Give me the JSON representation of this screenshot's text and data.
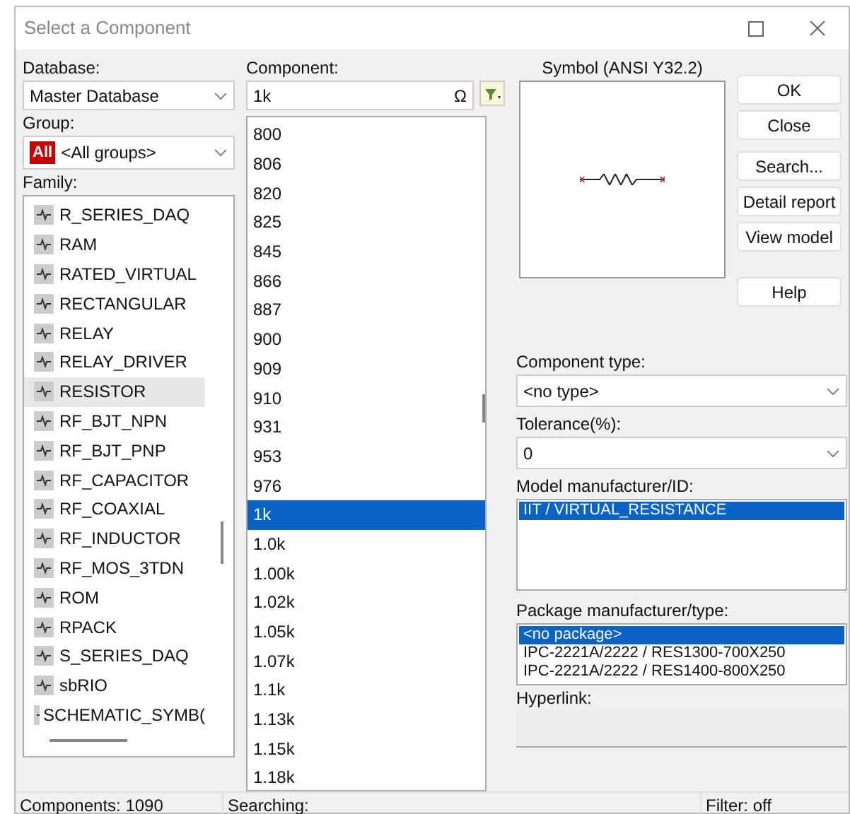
{
  "window": {
    "title": "Select a Component"
  },
  "database": {
    "label": "Database:",
    "value": "Master Database"
  },
  "group": {
    "label": "Group:",
    "badge": "All",
    "value": "<All groups>"
  },
  "family": {
    "label": "Family:",
    "items": [
      {
        "label": "R_SERIES_DAQ",
        "selected": false
      },
      {
        "label": "RAM",
        "selected": false
      },
      {
        "label": "RATED_VIRTUAL",
        "selected": false
      },
      {
        "label": "RECTANGULAR",
        "selected": false
      },
      {
        "label": "RELAY",
        "selected": false
      },
      {
        "label": "RELAY_DRIVER",
        "selected": false
      },
      {
        "label": "RESISTOR",
        "selected": true
      },
      {
        "label": "RF_BJT_NPN",
        "selected": false
      },
      {
        "label": "RF_BJT_PNP",
        "selected": false
      },
      {
        "label": "RF_CAPACITOR",
        "selected": false
      },
      {
        "label": "RF_COAXIAL",
        "selected": false
      },
      {
        "label": "RF_INDUCTOR",
        "selected": false
      },
      {
        "label": "RF_MOS_3TDN",
        "selected": false
      },
      {
        "label": "ROM",
        "selected": false
      },
      {
        "label": "RPACK",
        "selected": false
      },
      {
        "label": "S_SERIES_DAQ",
        "selected": false
      },
      {
        "label": "sbRIO",
        "selected": false
      },
      {
        "label": "SCHEMATIC_SYMB(",
        "selected": false
      }
    ]
  },
  "component": {
    "label": "Component:",
    "value": "1k",
    "omega_button": "Ω",
    "items": [
      {
        "label": "800",
        "selected": false
      },
      {
        "label": "806",
        "selected": false
      },
      {
        "label": "820",
        "selected": false
      },
      {
        "label": "825",
        "selected": false
      },
      {
        "label": "845",
        "selected": false
      },
      {
        "label": "866",
        "selected": false
      },
      {
        "label": "887",
        "selected": false
      },
      {
        "label": "900",
        "selected": false
      },
      {
        "label": "909",
        "selected": false
      },
      {
        "label": "910",
        "selected": false
      },
      {
        "label": "931",
        "selected": false
      },
      {
        "label": "953",
        "selected": false
      },
      {
        "label": "976",
        "selected": false
      },
      {
        "label": "1k",
        "selected": true
      },
      {
        "label": "1.0k",
        "selected": false
      },
      {
        "label": "1.00k",
        "selected": false
      },
      {
        "label": "1.02k",
        "selected": false
      },
      {
        "label": "1.05k",
        "selected": false
      },
      {
        "label": "1.07k",
        "selected": false
      },
      {
        "label": "1.1k",
        "selected": false
      },
      {
        "label": "1.13k",
        "selected": false
      },
      {
        "label": "1.15k",
        "selected": false
      },
      {
        "label": "1.18k",
        "selected": false
      }
    ]
  },
  "symbol": {
    "label": "Symbol (ANSI Y32.2)"
  },
  "buttons": [
    {
      "label": "OK"
    },
    {
      "label": "Close"
    },
    {
      "label": "Search..."
    },
    {
      "label": "Detail report"
    },
    {
      "label": "View model"
    },
    {
      "label": "Help"
    }
  ],
  "component_type": {
    "label": "Component type:",
    "value": "<no type>"
  },
  "tolerance": {
    "label": "Tolerance(%):",
    "value": "0"
  },
  "model": {
    "label": "Model manufacturer/ID:",
    "items": [
      {
        "label": "IIT / VIRTUAL_RESISTANCE",
        "selected": true
      }
    ]
  },
  "package": {
    "label": "Package manufacturer/type:",
    "items": [
      {
        "label": "<no package>",
        "selected": true
      },
      {
        "label": "IPC-2221A/2222 / RES1300-700X250",
        "selected": false
      },
      {
        "label": "IPC-2221A/2222 / RES1400-800X250",
        "selected": false
      }
    ]
  },
  "hyperlink": {
    "label": "Hyperlink:"
  },
  "status_bar": [
    "Components: 1090",
    "Searching:",
    "Filter: off"
  ]
}
